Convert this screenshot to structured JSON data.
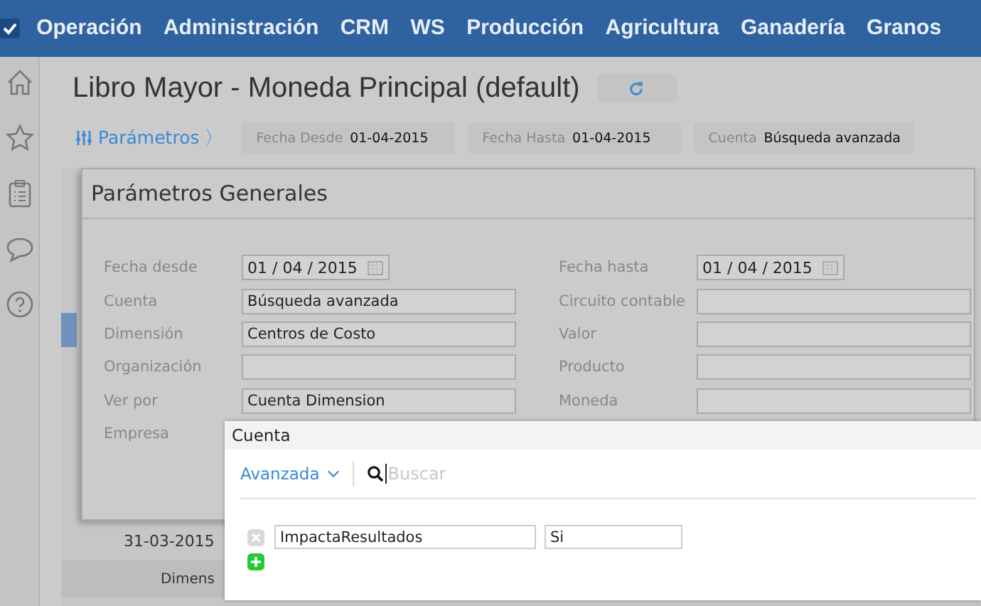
{
  "nav": {
    "items": [
      "Operación",
      "Administración",
      "CRM",
      "WS",
      "Producción",
      "Agricultura",
      "Ganadería",
      "Granos"
    ]
  },
  "page": {
    "title": "Libro Mayor - Moneda Principal (default)",
    "params_link": "Parámetros",
    "params_arrow": "〉",
    "chips": [
      {
        "label": "Fecha Desde",
        "value": "01-04-2015"
      },
      {
        "label": "Fecha Hasta",
        "value": "01-04-2015"
      },
      {
        "label": "Cuenta",
        "value": "Búsqueda avanzada"
      }
    ]
  },
  "background_table": {
    "date": "31-03-2015",
    "column_header": "Dimens"
  },
  "modal": {
    "title": "Parámetros Generales",
    "left_fields": [
      {
        "label": "Fecha desde",
        "kind": "date",
        "value": "01 / 04 / 2015"
      },
      {
        "label": "Cuenta",
        "kind": "text",
        "value": "Búsqueda avanzada"
      },
      {
        "label": "Dimensión",
        "kind": "text",
        "value": "Centros de Costo"
      },
      {
        "label": "Organización",
        "kind": "text"
      },
      {
        "label": "Ver por",
        "kind": "text",
        "value": "Cuenta Dimension"
      },
      {
        "label": "Empresa",
        "kind": "hidden"
      }
    ],
    "right_fields": [
      {
        "label": "Fecha hasta",
        "kind": "date",
        "value": "01 / 04 / 2015"
      },
      {
        "label": "Circuito contable",
        "kind": "text"
      },
      {
        "label": "Valor",
        "kind": "text"
      },
      {
        "label": "Producto",
        "kind": "text"
      },
      {
        "label": "Moneda",
        "kind": "text"
      }
    ]
  },
  "popup": {
    "title": "Cuenta",
    "mode": "Avanzada",
    "search_placeholder": "Buscar",
    "filters": [
      {
        "field": "ImpactaResultados",
        "value": "Si"
      }
    ]
  }
}
